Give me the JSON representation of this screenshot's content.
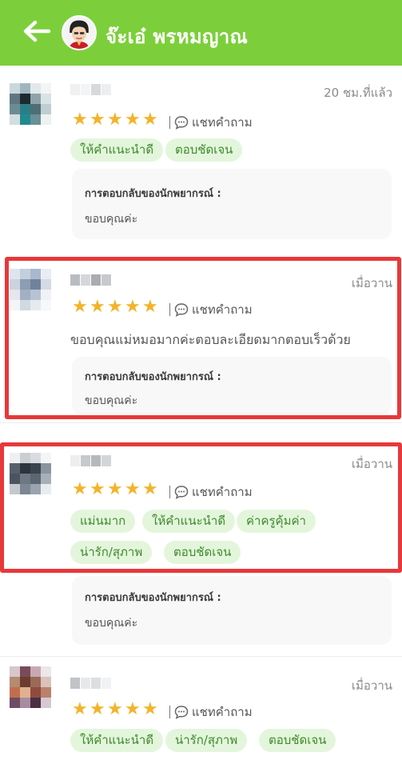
{
  "header": {
    "title": "จ๊ะเอ๋ พรหมญาณ"
  },
  "review_meta": {
    "chat_label": "แชทคำถาม",
    "reply_title": "การตอบกลับของนักพยากรณ์ :"
  },
  "reviews": [
    {
      "time": "20 ชม.ที่แล้ว",
      "rating": 5,
      "tags": [
        "ให้คำแนะนำดี",
        "ตอบชัดเจน"
      ],
      "reply": "ขอบคุณค่ะ"
    },
    {
      "time": "เมื่อวาน",
      "rating": 5,
      "comment": "ขอบคุณแม่หมอมากค่ะตอบละเอียดมากตอบเร็วด้วย",
      "reply": "ขอบคุณค่ะ"
    },
    {
      "time": "เมื่อวาน",
      "rating": 5,
      "tags": [
        "แม่นมาก",
        "ให้คำแนะนำดี",
        "ค่าครูคุ้มค่า",
        "น่ารัก/สุภาพ",
        "ตอบชัดเจน"
      ],
      "reply": "ขอบคุณค่ะ"
    },
    {
      "time": "เมื่อวาน",
      "rating": 5,
      "tags": [
        "ให้คำแนะนำดี",
        "น่ารัก/สุภาพ",
        "ตอบชัดเจน"
      ]
    }
  ],
  "colors": {
    "header_green": "#7ccf3a",
    "star": "#f3b32a",
    "tag_bg": "#e3f6dc",
    "tag_text": "#3f8a2c",
    "highlight_red": "#e7383a"
  },
  "icons": [
    "back-arrow-icon",
    "star-icon",
    "chat-bubble-icon"
  ]
}
